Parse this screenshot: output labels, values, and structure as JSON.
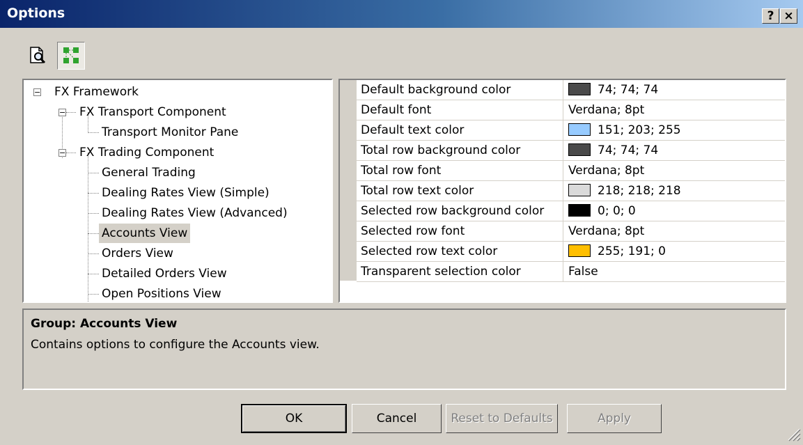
{
  "window": {
    "title": "Options",
    "help_button": "?",
    "close_button": "×"
  },
  "toolbar": {
    "buttons": [
      {
        "icon": "print-preview-icon"
      },
      {
        "icon": "tree-view-icon",
        "pressed": true
      }
    ]
  },
  "tree": {
    "items": [
      {
        "label": "FX Framework",
        "level": 0,
        "expander": "−"
      },
      {
        "label": "FX Transport Component",
        "level": 1,
        "expander": "−"
      },
      {
        "label": "Transport Monitor Pane",
        "level": 2
      },
      {
        "label": "FX Trading Component",
        "level": 1,
        "expander": "−"
      },
      {
        "label": "General Trading",
        "level": 2
      },
      {
        "label": "Dealing Rates View (Simple)",
        "level": 2
      },
      {
        "label": "Dealing Rates View (Advanced)",
        "level": 2
      },
      {
        "label": "Accounts View",
        "level": 2,
        "selected": true
      },
      {
        "label": "Orders View",
        "level": 2
      },
      {
        "label": "Detailed Orders View",
        "level": 2
      },
      {
        "label": "Open Positions View",
        "level": 2
      }
    ]
  },
  "properties": [
    {
      "name": "Default background color",
      "value": "74; 74; 74",
      "swatch": "#4a4a4a"
    },
    {
      "name": "Default font",
      "value": "Verdana; 8pt"
    },
    {
      "name": "Default text color",
      "value": "151; 203; 255",
      "swatch": "#97cbff"
    },
    {
      "name": "Total row background color",
      "value": "74; 74; 74",
      "swatch": "#4a4a4a"
    },
    {
      "name": "Total row font",
      "value": "Verdana; 8pt"
    },
    {
      "name": "Total row text color",
      "value": "218; 218; 218",
      "swatch": "#dadada"
    },
    {
      "name": "Selected row background color",
      "value": "0; 0; 0",
      "swatch": "#000000"
    },
    {
      "name": "Selected row font",
      "value": "Verdana; 8pt"
    },
    {
      "name": "Selected row text color",
      "value": "255; 191; 0",
      "swatch": "#ffbf00"
    },
    {
      "name": "Transparent selection color",
      "value": "False"
    }
  ],
  "info": {
    "title": "Group: Accounts View",
    "description": "Contains options to configure the Accounts view."
  },
  "buttons": {
    "ok": "OK",
    "cancel": "Cancel",
    "reset": "Reset to Defaults",
    "apply": "Apply"
  }
}
